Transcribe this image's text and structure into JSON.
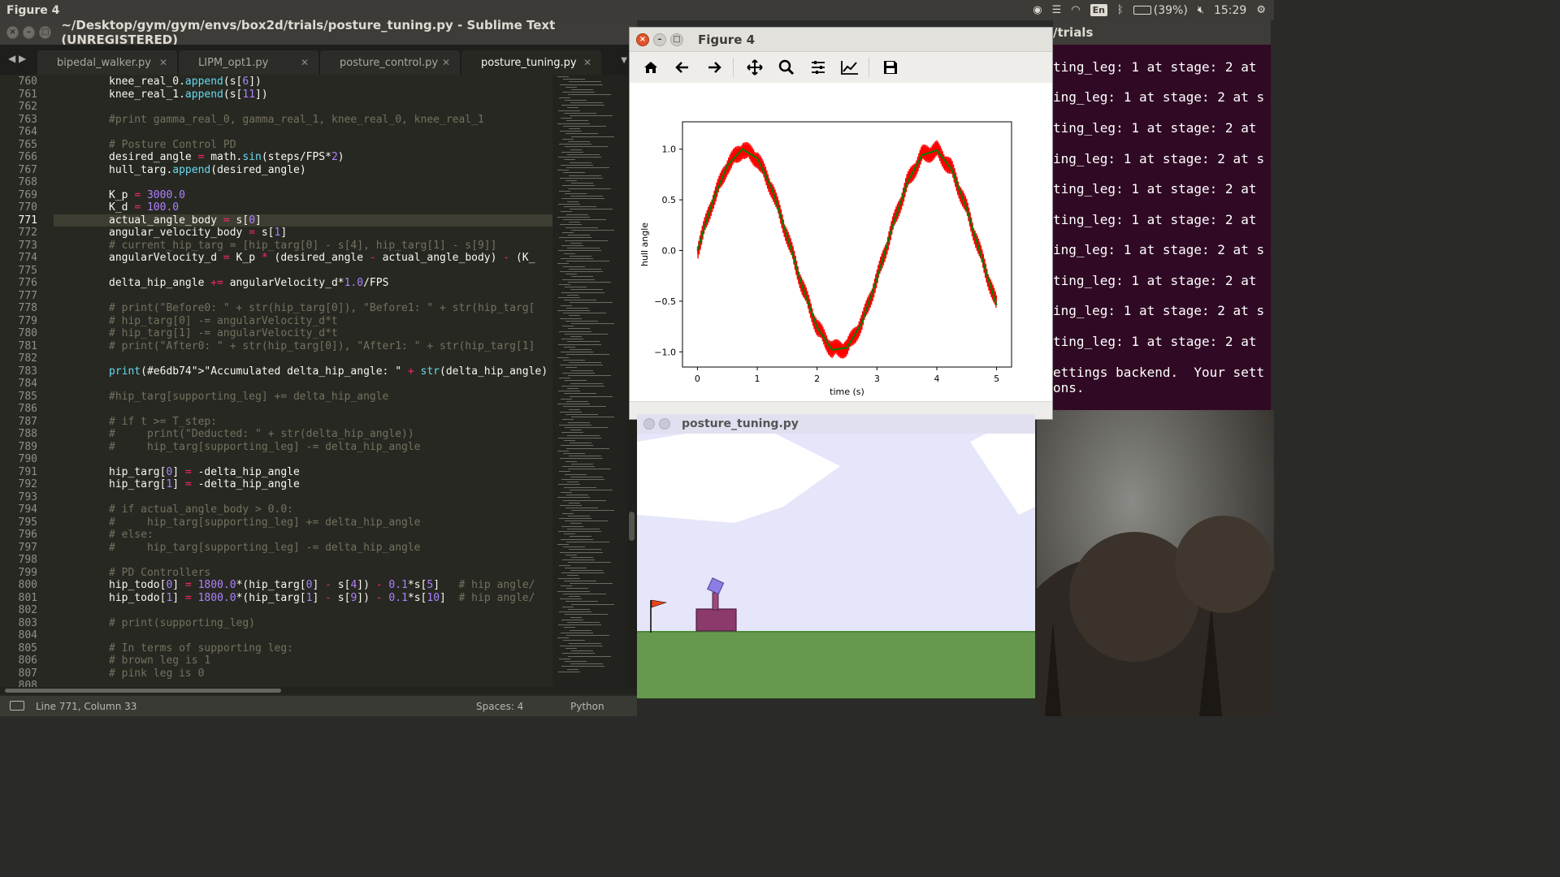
{
  "top_panel": {
    "app_title": "Figure 4",
    "battery_text": "(39%)",
    "keyboard_lang": "En",
    "clock": "15:29"
  },
  "sublime": {
    "window_title": "~/Desktop/gym/gym/envs/box2d/trials/posture_tuning.py - Sublime Text (UNREGISTERED)",
    "tabs": [
      {
        "label": "bipedal_walker.py"
      },
      {
        "label": "LIPM_opt1.py"
      },
      {
        "label": "posture_control.py"
      },
      {
        "label": "posture_tuning.py"
      }
    ],
    "lines": [
      {
        "n": "760",
        "code": "knee_real_0.append(s[6])"
      },
      {
        "n": "761",
        "code": "knee_real_1.append(s[11])"
      },
      {
        "n": "762",
        "code": ""
      },
      {
        "n": "763",
        "code": "#print gamma_real_0, gamma_real_1, knee_real_0, knee_real_1"
      },
      {
        "n": "764",
        "code": ""
      },
      {
        "n": "765",
        "code": "# Posture Control PD"
      },
      {
        "n": "766",
        "code": "desired_angle = math.sin(steps/FPS*2)"
      },
      {
        "n": "767",
        "code": "hull_targ.append(desired_angle)"
      },
      {
        "n": "768",
        "code": ""
      },
      {
        "n": "769",
        "code": "K_p = 3000.0"
      },
      {
        "n": "770",
        "code": "K_d = 100.0"
      },
      {
        "n": "771",
        "code": "actual_angle_body = s[0]"
      },
      {
        "n": "772",
        "code": "angular_velocity_body = s[1]"
      },
      {
        "n": "773",
        "code": "# current_hip_targ = [hip_targ[0] - s[4], hip_targ[1] - s[9]]"
      },
      {
        "n": "774",
        "code": "angularVelocity_d = K_p * (desired_angle - actual_angle_body) - (K_"
      },
      {
        "n": "775",
        "code": ""
      },
      {
        "n": "776",
        "code": "delta_hip_angle += angularVelocity_d*1.0/FPS"
      },
      {
        "n": "777",
        "code": ""
      },
      {
        "n": "778",
        "code": "# print(\"Before0: \" + str(hip_targ[0]), \"Before1: \" + str(hip_targ["
      },
      {
        "n": "779",
        "code": "# hip_targ[0] -= angularVelocity_d*t"
      },
      {
        "n": "780",
        "code": "# hip_targ[1] -= angularVelocity_d*t"
      },
      {
        "n": "781",
        "code": "# print(\"After0: \" + str(hip_targ[0]), \"After1: \" + str(hip_targ[1]"
      },
      {
        "n": "782",
        "code": ""
      },
      {
        "n": "783",
        "code": "print(\"Accumulated delta_hip_angle: \" + str(delta_hip_angle) + \" at"
      },
      {
        "n": "784",
        "code": ""
      },
      {
        "n": "785",
        "code": "#hip_targ[supporting_leg] += delta_hip_angle"
      },
      {
        "n": "786",
        "code": ""
      },
      {
        "n": "787",
        "code": "# if t >= T_step:"
      },
      {
        "n": "788",
        "code": "#     print(\"Deducted: \" + str(delta_hip_angle))"
      },
      {
        "n": "789",
        "code": "#     hip_targ[supporting_leg] -= delta_hip_angle"
      },
      {
        "n": "790",
        "code": ""
      },
      {
        "n": "791",
        "code": "hip_targ[0] = -delta_hip_angle"
      },
      {
        "n": "792",
        "code": "hip_targ[1] = -delta_hip_angle"
      },
      {
        "n": "793",
        "code": ""
      },
      {
        "n": "794",
        "code": "# if actual_angle_body > 0.0:"
      },
      {
        "n": "795",
        "code": "#     hip_targ[supporting_leg] += delta_hip_angle"
      },
      {
        "n": "796",
        "code": "# else:"
      },
      {
        "n": "797",
        "code": "#     hip_targ[supporting_leg] -= delta_hip_angle"
      },
      {
        "n": "798",
        "code": ""
      },
      {
        "n": "799",
        "code": "# PD Controllers"
      },
      {
        "n": "800",
        "code": "hip_todo[0] = 1800.0*(hip_targ[0] - s[4]) - 0.1*s[5]   # hip angle/"
      },
      {
        "n": "801",
        "code": "hip_todo[1] = 1800.0*(hip_targ[1] - s[9]) - 0.1*s[10]  # hip angle/"
      },
      {
        "n": "802",
        "code": ""
      },
      {
        "n": "803",
        "code": "# print(supporting_leg)"
      },
      {
        "n": "804",
        "code": ""
      },
      {
        "n": "805",
        "code": "# In terms of supporting leg:"
      },
      {
        "n": "806",
        "code": "# brown leg is 1"
      },
      {
        "n": "807",
        "code": "# pink leg is 0"
      },
      {
        "n": "808",
        "code": ""
      }
    ],
    "current_line": "771",
    "status": {
      "position": "Line 771, Column 33",
      "indent": "Spaces: 4",
      "syntax": "Python"
    },
    "colors": {
      "background": "#272822",
      "keyword": "#f92672",
      "number": "#ae81ff",
      "function": "#66d9ef",
      "string": "#e6db74",
      "comment": "#75715e"
    }
  },
  "terminal": {
    "title_fragment": "/trials",
    "lines": [
      "ting_leg: 1 at stage: 2 at",
      "ing_leg: 1 at stage: 2 at s",
      "ting_leg: 1 at stage: 2 at",
      "ing_leg: 1 at stage: 2 at s",
      "ting_leg: 1 at stage: 2 at",
      "ting_leg: 1 at stage: 2 at",
      "ing_leg: 1 at stage: 2 at s",
      "ting_leg: 1 at stage: 2 at",
      "ing_leg: 1 at stage: 2 at s",
      "ting_leg: 1 at stage: 2 at",
      "ettings backend.  Your sett",
      "ons."
    ]
  },
  "figure": {
    "window_title": "Figure 4",
    "toolbar": [
      "home-icon",
      "back-icon",
      "forward-icon",
      "pan-icon",
      "zoom-icon",
      "subplots-icon",
      "customize-icon",
      "save-icon"
    ]
  },
  "chart_data": {
    "type": "line",
    "xlabel": "time (s)",
    "ylabel": "hull angle",
    "xlim": [
      -0.25,
      5.25
    ],
    "ylim": [
      -1.15,
      1.27
    ],
    "xticks": [
      "0",
      "1",
      "2",
      "3",
      "4",
      "5"
    ],
    "yticks": [
      "−1.0",
      "−0.5",
      "0.0",
      "0.5",
      "1.0"
    ],
    "grid": false,
    "series": [
      {
        "color": "#ff0000",
        "kind": "noisy sine (actual)",
        "x": [
          0,
          0.25,
          0.5,
          0.75,
          1.0,
          1.25,
          1.5,
          1.75,
          2.0,
          2.25,
          2.5,
          2.75,
          3.0,
          3.25,
          3.5,
          3.75,
          4.0,
          4.25,
          4.5,
          4.75,
          5.0
        ],
        "y": [
          0.0,
          0.48,
          0.84,
          1.0,
          0.91,
          0.6,
          0.14,
          -0.35,
          -0.76,
          -0.98,
          -0.96,
          -0.71,
          -0.28,
          0.22,
          0.66,
          0.94,
          0.99,
          0.8,
          0.41,
          -0.07,
          -0.54
        ]
      },
      {
        "color": "#008000",
        "kind": "sine (target)",
        "x": [
          0,
          0.25,
          0.5,
          0.75,
          1.0,
          1.25,
          1.5,
          1.75,
          2.0,
          2.25,
          2.5,
          2.75,
          3.0,
          3.25,
          3.5,
          3.75,
          4.0,
          4.25,
          4.5,
          4.75,
          5.0
        ],
        "y": [
          0.0,
          0.48,
          0.84,
          1.0,
          0.91,
          0.6,
          0.14,
          -0.35,
          -0.76,
          -0.98,
          -0.96,
          -0.71,
          -0.28,
          0.22,
          0.66,
          0.94,
          0.99,
          0.8,
          0.41,
          -0.07,
          -0.54
        ]
      }
    ]
  },
  "pygame": {
    "window_title": "posture_tuning.py",
    "colors": {
      "sky": "#e6e6fa",
      "ground": "#66994d",
      "hull": "#8b3a6b",
      "head": "#8a7ee6",
      "flag": "#e8441a"
    }
  }
}
